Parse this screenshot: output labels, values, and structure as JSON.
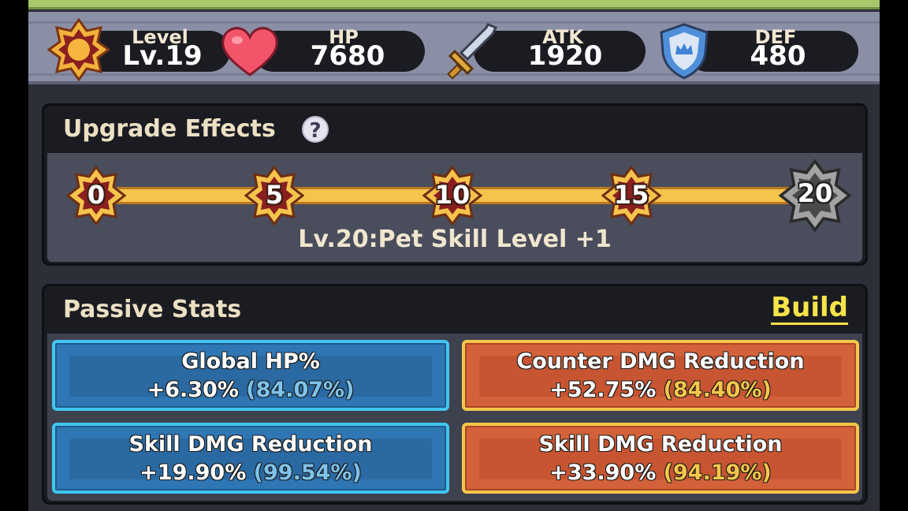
{
  "stats": {
    "level": {
      "label": "Level",
      "value": "Lv.19"
    },
    "hp": {
      "label": "HP",
      "value": "7680"
    },
    "atk": {
      "label": "ATK",
      "value": "1920"
    },
    "def": {
      "label": "DEF",
      "value": "480"
    }
  },
  "upgrade": {
    "title": "Upgrade Effects",
    "help_glyph": "?",
    "milestones": [
      "0",
      "5",
      "10",
      "15",
      "20"
    ],
    "effect_text": "Lv.20:Pet Skill Level +1"
  },
  "passive": {
    "title": "Passive Stats",
    "build_label": "Build",
    "cards": [
      {
        "name": "Global HP%",
        "bonus": "+6.30%",
        "total": "(84.07%)",
        "color": "blue"
      },
      {
        "name": "Counter DMG Reduction",
        "bonus": "+52.75%",
        "total": "(84.40%)",
        "color": "orange"
      },
      {
        "name": "Skill DMG Reduction",
        "bonus": "+19.90%",
        "total": "(99.54%)",
        "color": "blue"
      },
      {
        "name": "Skill DMG Reduction",
        "bonus": "+33.90%",
        "total": "(94.19%)",
        "color": "orange"
      }
    ]
  },
  "colors": {
    "blue_card": "#2f76b4",
    "orange_card": "#d3623a",
    "track": "#f6c34d",
    "build": "#f7e44a"
  }
}
